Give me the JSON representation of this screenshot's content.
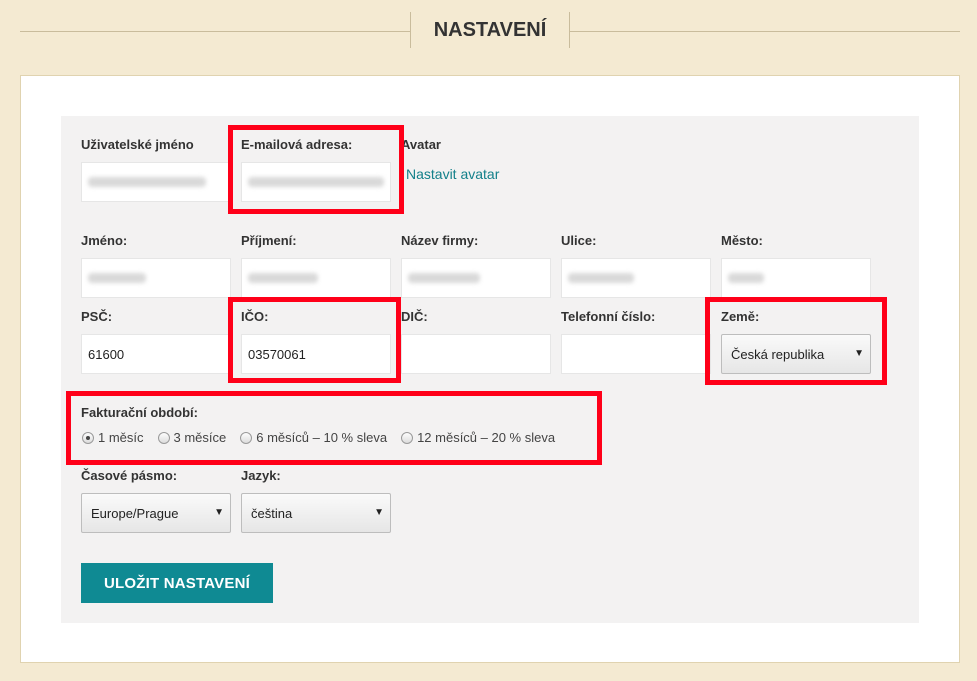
{
  "page": {
    "title": "NASTAVENÍ"
  },
  "form": {
    "username_label": "Uživatelské jméno",
    "email_label": "E-mailová adresa:",
    "avatar_label": "Avatar",
    "avatar_link": "Nastavit avatar",
    "first_name_label": "Jméno:",
    "last_name_label": "Příjmení:",
    "company_label": "Název firmy:",
    "street_label": "Ulice:",
    "city_label": "Město:",
    "zip_label": "PSČ:",
    "zip_value": "61600",
    "ico_label": "IČO:",
    "ico_value": "03570061",
    "dic_label": "DIČ:",
    "phone_label": "Telefonní číslo:",
    "country_label": "Země:",
    "country_value": "Česká republika",
    "billing_label": "Fakturační období:",
    "billing_options": [
      "1 měsíc",
      "3 měsíce",
      "6 měsíců – 10 % sleva",
      "12 měsíců – 20 % sleva"
    ],
    "billing_selected_index": 0,
    "timezone_label": "Časové pásmo:",
    "timezone_value": "Europe/Prague",
    "language_label": "Jazyk:",
    "language_value": "čeština",
    "save_button": "ULOŽIT NASTAVENÍ"
  },
  "colors": {
    "accent": "#0f8a93",
    "highlight": "#ff0019",
    "background": "#f4ead2"
  }
}
